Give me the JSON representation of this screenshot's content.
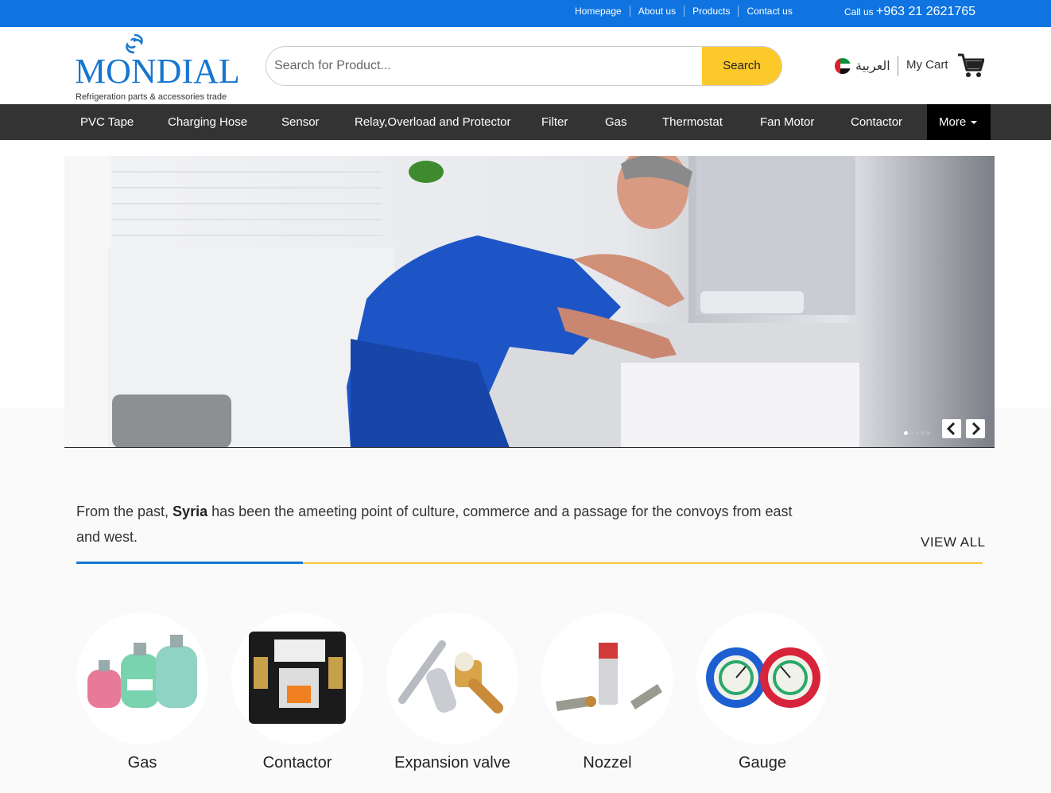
{
  "topbar": {
    "links": [
      "Homepage",
      "About us",
      "Products",
      "Contact us"
    ],
    "call_label": "Call us",
    "phone": "+963 21 2621765"
  },
  "header": {
    "logo_name": "MONDIAL",
    "logo_tagline": "Refrigeration parts & accessories trade",
    "search_placeholder": "Search for Product...",
    "search_button": "Search",
    "language": "العربية",
    "cart_label": "My Cart"
  },
  "nav": {
    "items": [
      "PVC Tape",
      "Charging Hose",
      "Sensor",
      "Relay,Overload and Protector",
      "Filter",
      "Gas",
      "Thermostat",
      "Fan Motor",
      "Contactor"
    ],
    "more": "More"
  },
  "hero": {
    "slides": 5,
    "active_slide": 1
  },
  "about": {
    "text_before": "From the past, ",
    "highlight": "Syria",
    "text_after": " has been the ameeting point of culture, commerce and a passage for the convoys from east and west.",
    "view_all": "VIEW ALL"
  },
  "categories": [
    "Gas",
    "Contactor",
    "Expansion valve",
    "Nozzel",
    "Gauge"
  ],
  "colors": {
    "topbar": "#0f74e0",
    "brand_blue": "#1776cf",
    "accent_yellow": "#fcc92b",
    "nav_bg": "#333333"
  }
}
